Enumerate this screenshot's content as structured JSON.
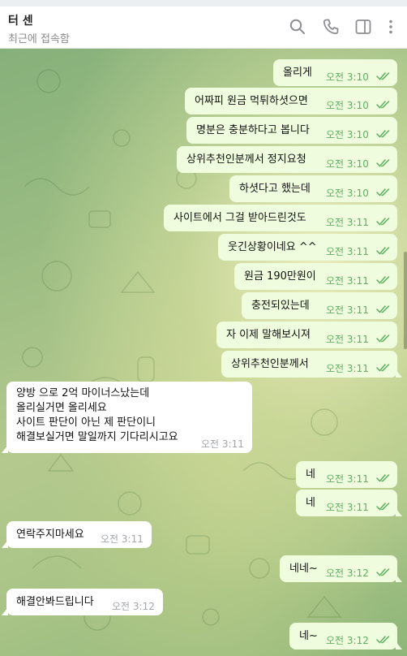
{
  "header": {
    "title": "터 센",
    "status": "최근에 접속함"
  },
  "messages": [
    {
      "dir": "out",
      "text": "올리게",
      "time": "오전 3:10"
    },
    {
      "dir": "out",
      "text": "어짜피 원금 먹튀하셧으면",
      "time": "오전 3:10"
    },
    {
      "dir": "out",
      "text": "명분은 충분하다고 봅니다",
      "time": "오전 3:10"
    },
    {
      "dir": "out",
      "text": "상위추천인분께서 정지요청",
      "time": "오전 3:10"
    },
    {
      "dir": "out",
      "text": "하셧다고 했는데",
      "time": "오전 3:10"
    },
    {
      "dir": "out",
      "text": "사이트에서 그걸 받아드린것도",
      "time": "오전 3:11"
    },
    {
      "dir": "out",
      "text": "웃긴상황이네요 ^^",
      "time": "오전 3:11"
    },
    {
      "dir": "out",
      "text": "원금 190만원이",
      "time": "오전 3:11"
    },
    {
      "dir": "out",
      "text": "충전되있는데",
      "time": "오전 3:11"
    },
    {
      "dir": "out",
      "text": "자 이제 말해보시져",
      "time": "오전 3:11"
    },
    {
      "dir": "out",
      "text": "상위추천인분께서",
      "time": "오전 3:11"
    },
    {
      "dir": "in",
      "lines": [
        "양방 으로 2억 마이너스났는데",
        "올리실거면 올리세요",
        "사이트 판단이 아닌 제 판단이니",
        "해결보실거면 말일까지 기다리시고요"
      ],
      "time": "오전 3:11"
    },
    {
      "dir": "out",
      "text": "네",
      "time": "오전 3:11"
    },
    {
      "dir": "out",
      "text": "네",
      "time": "오전 3:11"
    },
    {
      "dir": "in",
      "text": "연락주지마세요",
      "time": "오전 3:11"
    },
    {
      "dir": "out",
      "text": "네네~",
      "time": "오전 3:12"
    },
    {
      "dir": "in",
      "text": "해결안봐드립니다",
      "time": "오전 3:12"
    },
    {
      "dir": "out",
      "text": "네~",
      "time": "오전 3:12"
    }
  ],
  "colors": {
    "outgoing_bubble": "#effdde",
    "incoming_bubble": "#ffffff",
    "outgoing_time": "#5eaf61",
    "incoming_time": "#a3a7ab"
  },
  "icons": [
    "search-icon",
    "phone-icon",
    "sidebar-panel-icon",
    "more-vertical-icon",
    "double-check-icon"
  ]
}
